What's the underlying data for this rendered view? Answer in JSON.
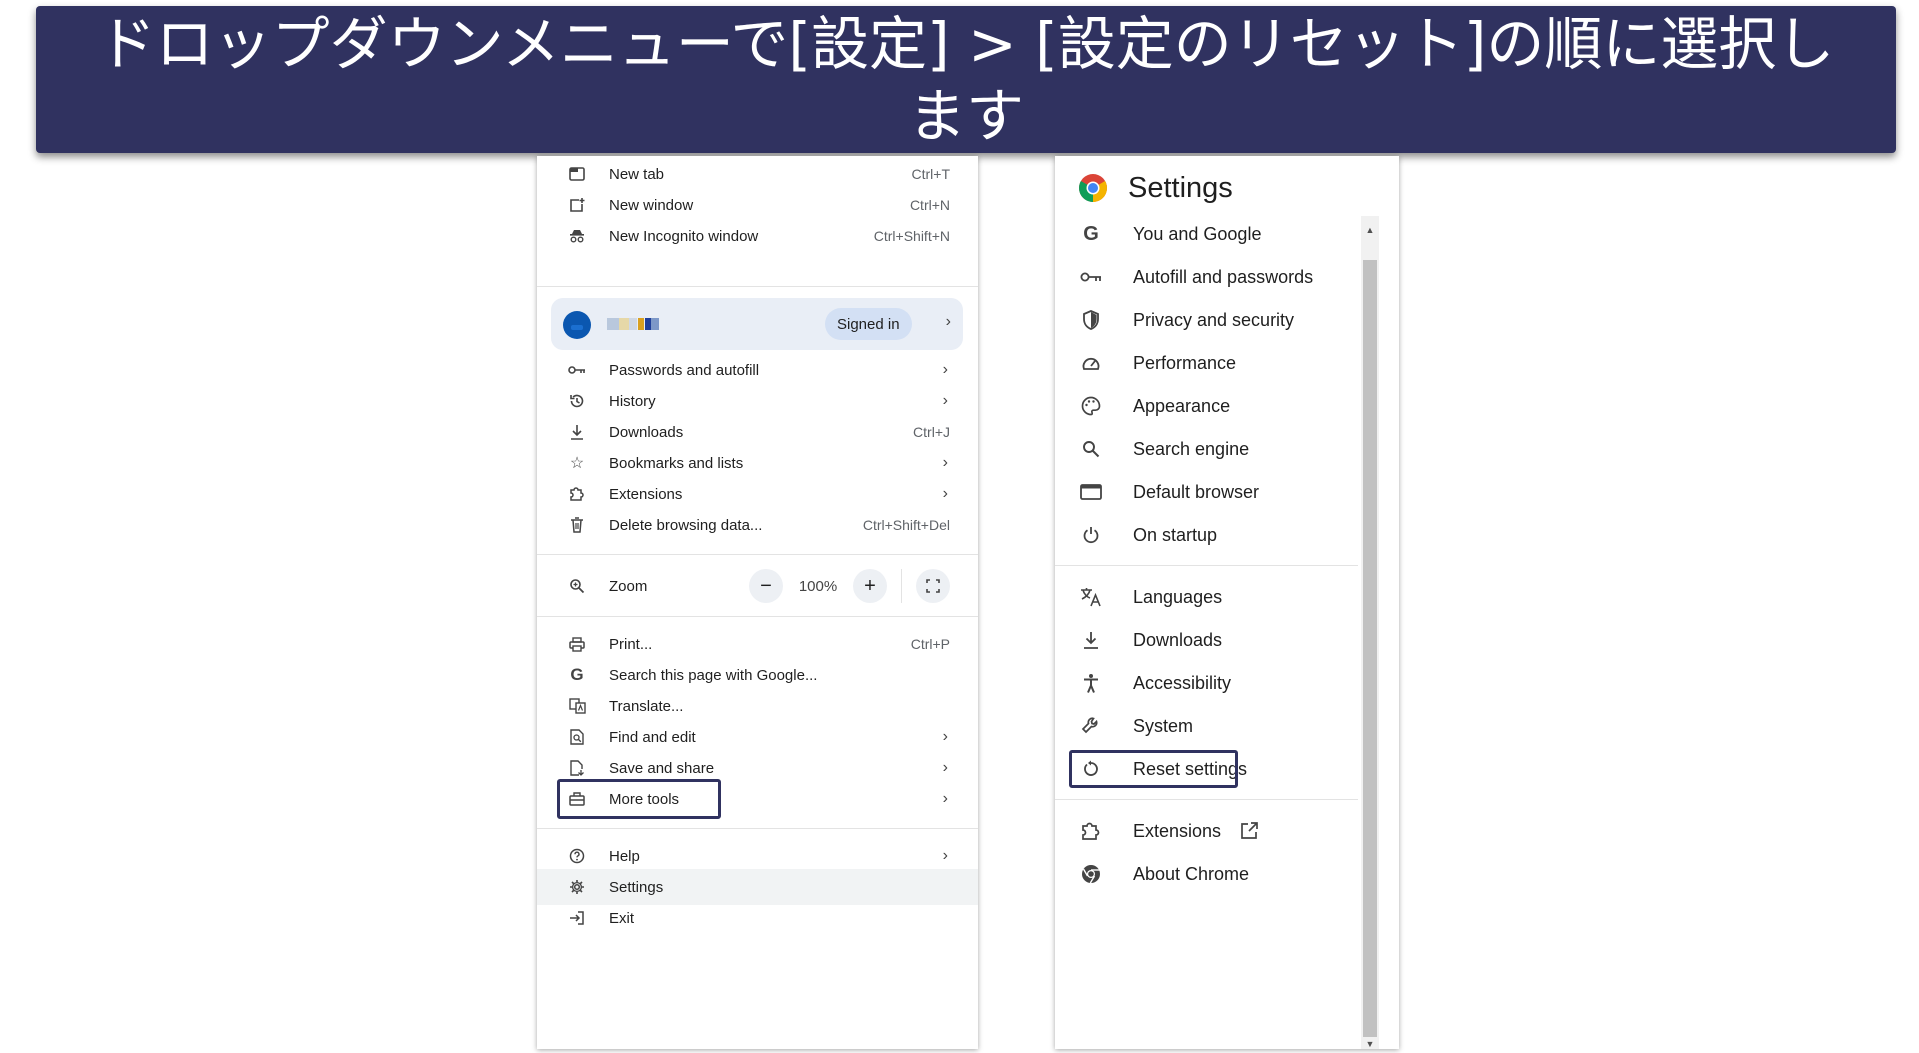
{
  "banner": {
    "text": "ドロップダウンメニューで[設定] > [設定のリセット]の順に選択します"
  },
  "menu": {
    "top_items": [
      {
        "label": "New tab",
        "shortcut": "Ctrl+T",
        "icon": "new-tab-icon"
      },
      {
        "label": "New window",
        "shortcut": "Ctrl+N",
        "icon": "new-window-icon"
      },
      {
        "label": "New Incognito window",
        "shortcut": "Ctrl+Shift+N",
        "icon": "incognito-icon"
      }
    ],
    "profile": {
      "status": "Signed in"
    },
    "items": [
      {
        "label": "Passwords and autofill",
        "icon": "key-icon"
      },
      {
        "label": "History",
        "icon": "history-icon"
      },
      {
        "label": "Downloads",
        "shortcut": "Ctrl+J",
        "icon": "download-icon"
      },
      {
        "label": "Bookmarks and lists",
        "icon": "star-icon"
      },
      {
        "label": "Extensions",
        "icon": "puzzle-icon"
      },
      {
        "label": "Delete browsing data...",
        "shortcut": "Ctrl+Shift+Del",
        "icon": "trash-icon"
      }
    ],
    "zoom": {
      "label": "Zoom",
      "minus": "−",
      "value": "100%",
      "plus": "+"
    },
    "tools": [
      {
        "label": "Print...",
        "shortcut": "Ctrl+P",
        "icon": "print-icon"
      },
      {
        "label": "Search this page with Google...",
        "icon": "google-icon"
      },
      {
        "label": "Translate...",
        "icon": "translate-icon"
      },
      {
        "label": "Find and edit",
        "icon": "find-icon"
      },
      {
        "label": "Save and share",
        "icon": "save-share-icon"
      },
      {
        "label": "More tools",
        "icon": "toolbox-icon"
      }
    ],
    "bottom": [
      {
        "label": "Help",
        "icon": "help-icon"
      },
      {
        "label": "Settings",
        "icon": "gear-icon"
      },
      {
        "label": "Exit",
        "icon": "exit-icon"
      }
    ]
  },
  "settings": {
    "title": "Settings",
    "items": [
      {
        "label": "You and Google",
        "icon": "google-icon"
      },
      {
        "label": "Autofill and passwords",
        "icon": "key-icon"
      },
      {
        "label": "Privacy and security",
        "icon": "shield-icon"
      },
      {
        "label": "Performance",
        "icon": "gauge-icon"
      },
      {
        "label": "Appearance",
        "icon": "palette-icon"
      },
      {
        "label": "Search engine",
        "icon": "search-icon"
      },
      {
        "label": "Default browser",
        "icon": "browser-icon"
      },
      {
        "label": "On startup",
        "icon": "power-icon"
      }
    ],
    "advanced": [
      {
        "label": "Languages",
        "icon": "language-icon"
      },
      {
        "label": "Downloads",
        "icon": "download-icon"
      },
      {
        "label": "Accessibility",
        "icon": "accessibility-icon"
      },
      {
        "label": "System",
        "icon": "wrench-icon"
      },
      {
        "label": "Reset settings",
        "icon": "reset-icon"
      }
    ],
    "footer": [
      {
        "label": "Extensions",
        "icon": "puzzle-icon"
      },
      {
        "label": "About Chrome",
        "icon": "chrome-icon"
      }
    ]
  },
  "colors": {
    "banner": "#303260",
    "highlight": "#303260",
    "profile_bg": "#e9eef6"
  }
}
